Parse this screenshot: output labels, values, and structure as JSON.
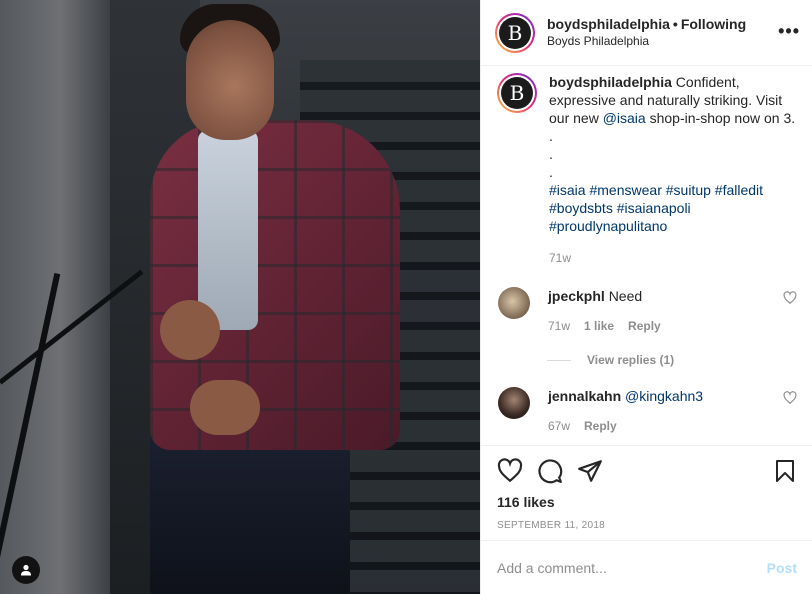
{
  "post": {
    "username": "boydsphiladelphia",
    "separator": "•",
    "follow_status": "Following",
    "location": "Boyds Philadelphia",
    "avatar_letter": "B",
    "more_label": "•••"
  },
  "caption": {
    "username": "boydsphiladelphia",
    "text_before": " Confident, expressive and naturally striking. Visit our new ",
    "mention": "@isaia",
    "text_after": " shop-in-shop now on 3.",
    "dots": [
      ".",
      ".",
      "."
    ],
    "hashtags": [
      "#isaia",
      "#menswear",
      "#suitup",
      "#falledit",
      "#boydsbts",
      "#isaianapoli",
      "#proudlynapulitano"
    ],
    "time": "71w"
  },
  "comments": [
    {
      "username": "jpeckphl",
      "text": "Need",
      "time": "71w",
      "likes": "1 like",
      "reply": "Reply",
      "view_replies": "View replies (1)"
    },
    {
      "username": "jennalkahn",
      "mention": "@kingkahn3",
      "time": "67w",
      "reply": "Reply"
    }
  ],
  "actions": {
    "icons": [
      "heart-icon",
      "comment-icon",
      "share-icon",
      "bookmark-icon"
    ],
    "likes": "116 likes",
    "date": "SEPTEMBER 11, 2018"
  },
  "add_comment": {
    "placeholder": "Add a comment...",
    "post_label": "Post"
  },
  "colors": {
    "link": "#00376b",
    "muted": "#8e8e8e",
    "post_disabled": "#b2dffc"
  }
}
